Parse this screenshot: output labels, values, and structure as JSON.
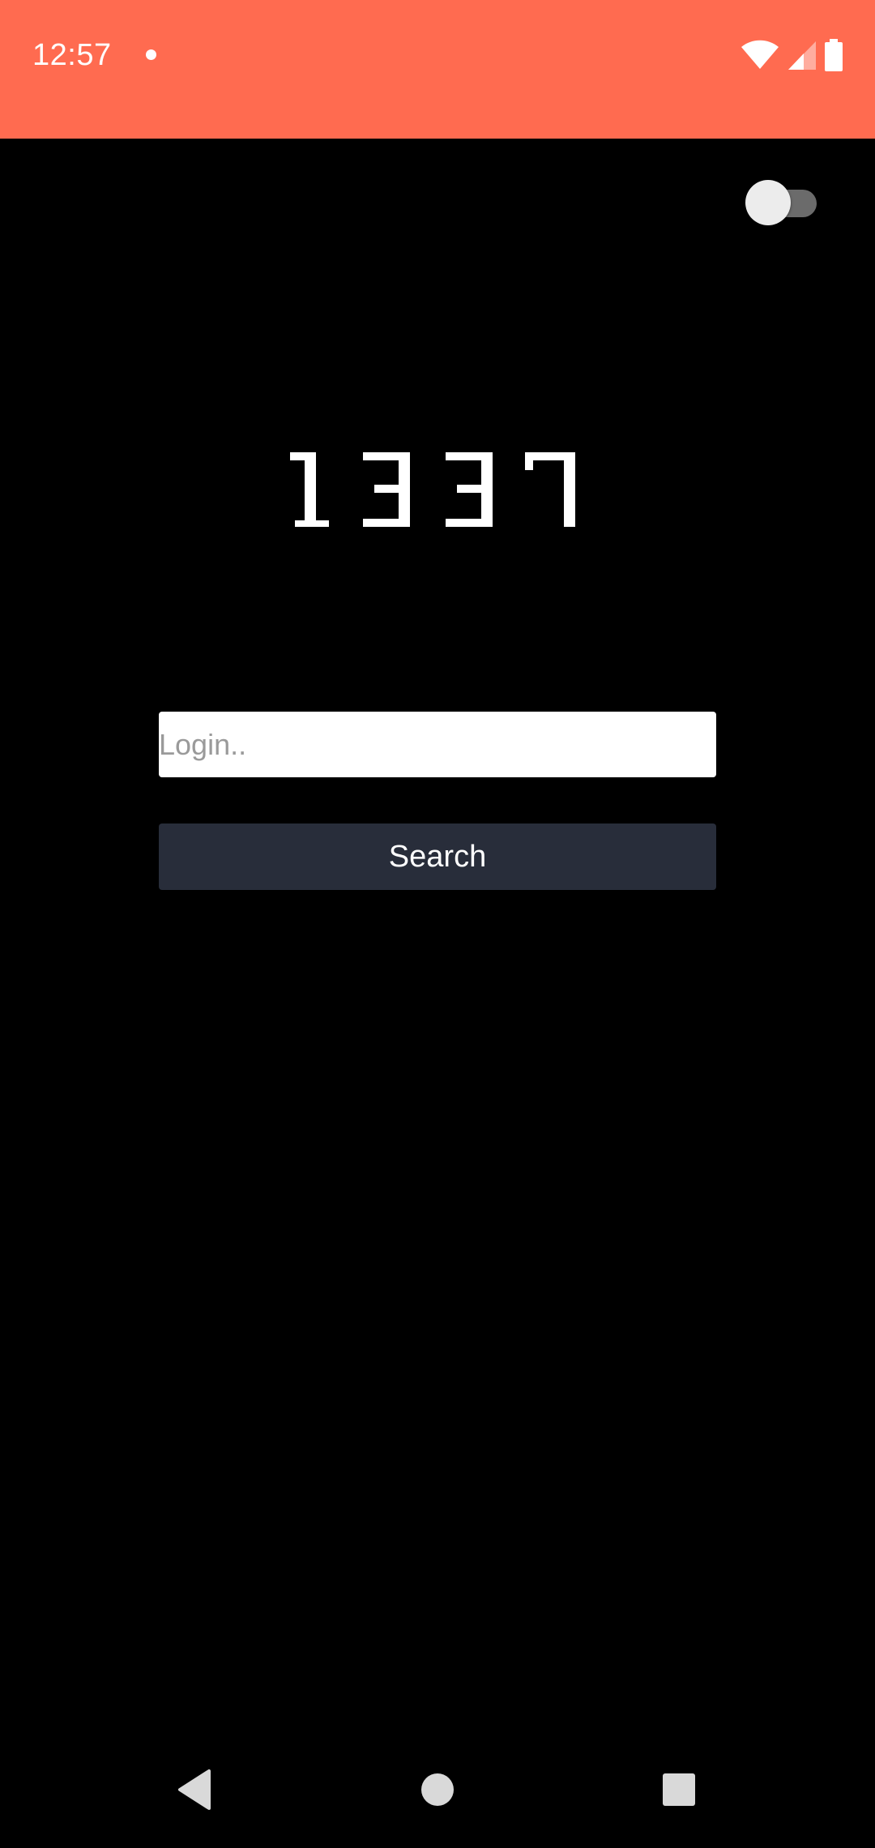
{
  "status_bar": {
    "time": "12:57",
    "background_color": "#ff6b50",
    "icons": [
      "notification-dot-icon",
      "wifi-icon",
      "cellular-signal-icon",
      "battery-icon"
    ]
  },
  "theme_toggle": {
    "state": "off"
  },
  "logo": {
    "text": "1337"
  },
  "login": {
    "placeholder": "Login..",
    "value": ""
  },
  "search_button": {
    "label": "Search",
    "color": "#282d3a"
  },
  "nav_bar": {
    "icons": [
      "back-icon",
      "home-icon",
      "recents-icon"
    ]
  }
}
